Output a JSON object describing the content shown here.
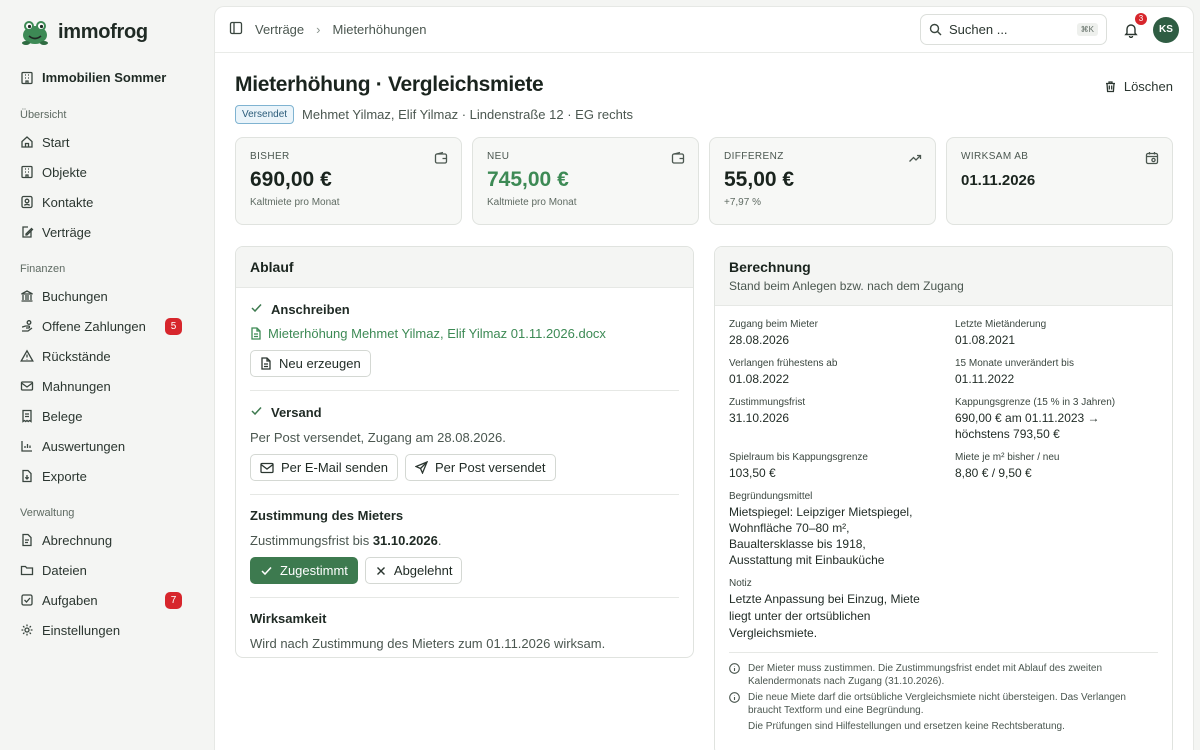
{
  "brand": {
    "name": "immofrog"
  },
  "sidebar": {
    "org": "Immobilien Sommer",
    "sections": [
      {
        "label": "Übersicht",
        "items": [
          {
            "label": "Start",
            "icon": "home-icon"
          },
          {
            "label": "Objekte",
            "icon": "building-icon"
          },
          {
            "label": "Kontakte",
            "icon": "contacts-icon"
          },
          {
            "label": "Verträge",
            "icon": "contract-icon"
          }
        ]
      },
      {
        "label": "Finanzen",
        "items": [
          {
            "label": "Buchungen",
            "icon": "bank-icon"
          },
          {
            "label": "Offene Zahlungen",
            "icon": "payment-icon",
            "badge": "5"
          },
          {
            "label": "Rückstände",
            "icon": "warning-icon"
          },
          {
            "label": "Mahnungen",
            "icon": "mail-icon"
          },
          {
            "label": "Belege",
            "icon": "receipt-icon"
          },
          {
            "label": "Auswertungen",
            "icon": "chart-icon"
          },
          {
            "label": "Exporte",
            "icon": "export-icon"
          }
        ]
      },
      {
        "label": "Verwaltung",
        "items": [
          {
            "label": "Abrechnung",
            "icon": "calculator-icon"
          },
          {
            "label": "Dateien",
            "icon": "folder-icon"
          },
          {
            "label": "Aufgaben",
            "icon": "task-icon",
            "badge": "7"
          },
          {
            "label": "Einstellungen",
            "icon": "gear-icon"
          }
        ]
      }
    ]
  },
  "topbar": {
    "breadcrumb": [
      "Verträge",
      "Mieterhöhungen"
    ],
    "search_placeholder": "Suchen ...",
    "search_kbd": "⌘K",
    "notifications": "3",
    "avatar": "KS"
  },
  "page": {
    "title": "Mieterhöhung · Vergleichsmiete",
    "delete_label": "Löschen",
    "status": "Versendet",
    "subtitle": "Mehmet Yilmaz, Elif Yilmaz · Lindenstraße 12 · EG rechts"
  },
  "cards": [
    {
      "label": "BISHER",
      "value": "690,00 €",
      "sub": "Kaltmiete pro Monat",
      "icon": "wallet-icon"
    },
    {
      "label": "NEU",
      "value": "745,00 €",
      "sub": "Kaltmiete pro Monat",
      "icon": "wallet-icon"
    },
    {
      "label": "DIFFERENZ",
      "value": "55,00 €",
      "sub": "+7,97 %",
      "icon": "trend-up-icon"
    },
    {
      "label": "WIRKSAM AB",
      "value": "01.11.2026",
      "sub": "",
      "icon": "calendar-icon"
    }
  ],
  "ablauf": {
    "title": "Ablauf",
    "anschreiben": {
      "title": "Anschreiben",
      "file": "Mieterhöhung Mehmet Yilmaz, Elif Yilmaz 01.11.2026.docx",
      "regen": "Neu erzeugen"
    },
    "versand": {
      "title": "Versand",
      "text": "Per Post versendet, Zugang am 28.08.2026.",
      "email_btn": "Per E-Mail senden",
      "post_btn": "Per Post versendet"
    },
    "zustimmung": {
      "title": "Zustimmung des Mieters",
      "text_prefix": "Zustimmungsfrist bis ",
      "date": "31.10.2026",
      "text_suffix": ".",
      "accept": "Zugestimmt",
      "reject": "Abgelehnt"
    },
    "wirksamkeit": {
      "title": "Wirksamkeit",
      "text": "Wird nach Zustimmung des Mieters zum 01.11.2026 wirksam."
    }
  },
  "berechnung": {
    "title": "Berechnung",
    "subtitle": "Stand beim Anlegen bzw. nach dem Zugang",
    "fields": [
      {
        "label": "Zugang beim Mieter",
        "value": "28.08.2026"
      },
      {
        "label": "Letzte Mietänderung",
        "value": "01.08.2021"
      },
      {
        "label": "Verlangen frühestens ab",
        "value": "01.08.2022"
      },
      {
        "label": "15 Monate unverändert bis",
        "value": "01.11.2022"
      },
      {
        "label": "Zustimmungsfrist",
        "value": "31.10.2026"
      },
      {
        "label": "Kappungsgrenze (15 % in 3 Jahren)",
        "value": "690,00 € am 01.11.2023 → höchstens 793,50 €"
      },
      {
        "label": "Spielraum bis Kappungsgrenze",
        "value": "103,50 €"
      },
      {
        "label": "Miete je m² bisher / neu",
        "value": "8,80 € / 9,50 €"
      },
      {
        "label": "Begründungsmittel",
        "value": "Mietspiegel: Leipziger Mietspiegel, Wohnfläche 70–80 m², Baualtersklasse bis 1918, Ausstattung mit Einbauküche"
      }
    ],
    "note_label": "Notiz",
    "note": "Letzte Anpassung bei Einzug, Miete liegt unter der ortsüblichen Vergleichsmiete.",
    "hints": [
      "Der Mieter muss zustimmen. Die Zustimmungsfrist endet mit Ablauf des zweiten Kalendermonats nach Zugang (31.10.2026).",
      "Die neue Miete darf die ortsübliche Vergleichsmiete nicht übersteigen. Das Verlangen braucht Textform und eine Begründung.",
      "Die Prüfungen sind Hilfestellungen und ersetzen keine Rechtsberatung."
    ]
  },
  "colors": {
    "accent": "#3d7a4f",
    "accent_text": "#3d8a55",
    "danger": "#d7262c",
    "status_blue": "#2b5c7a"
  }
}
